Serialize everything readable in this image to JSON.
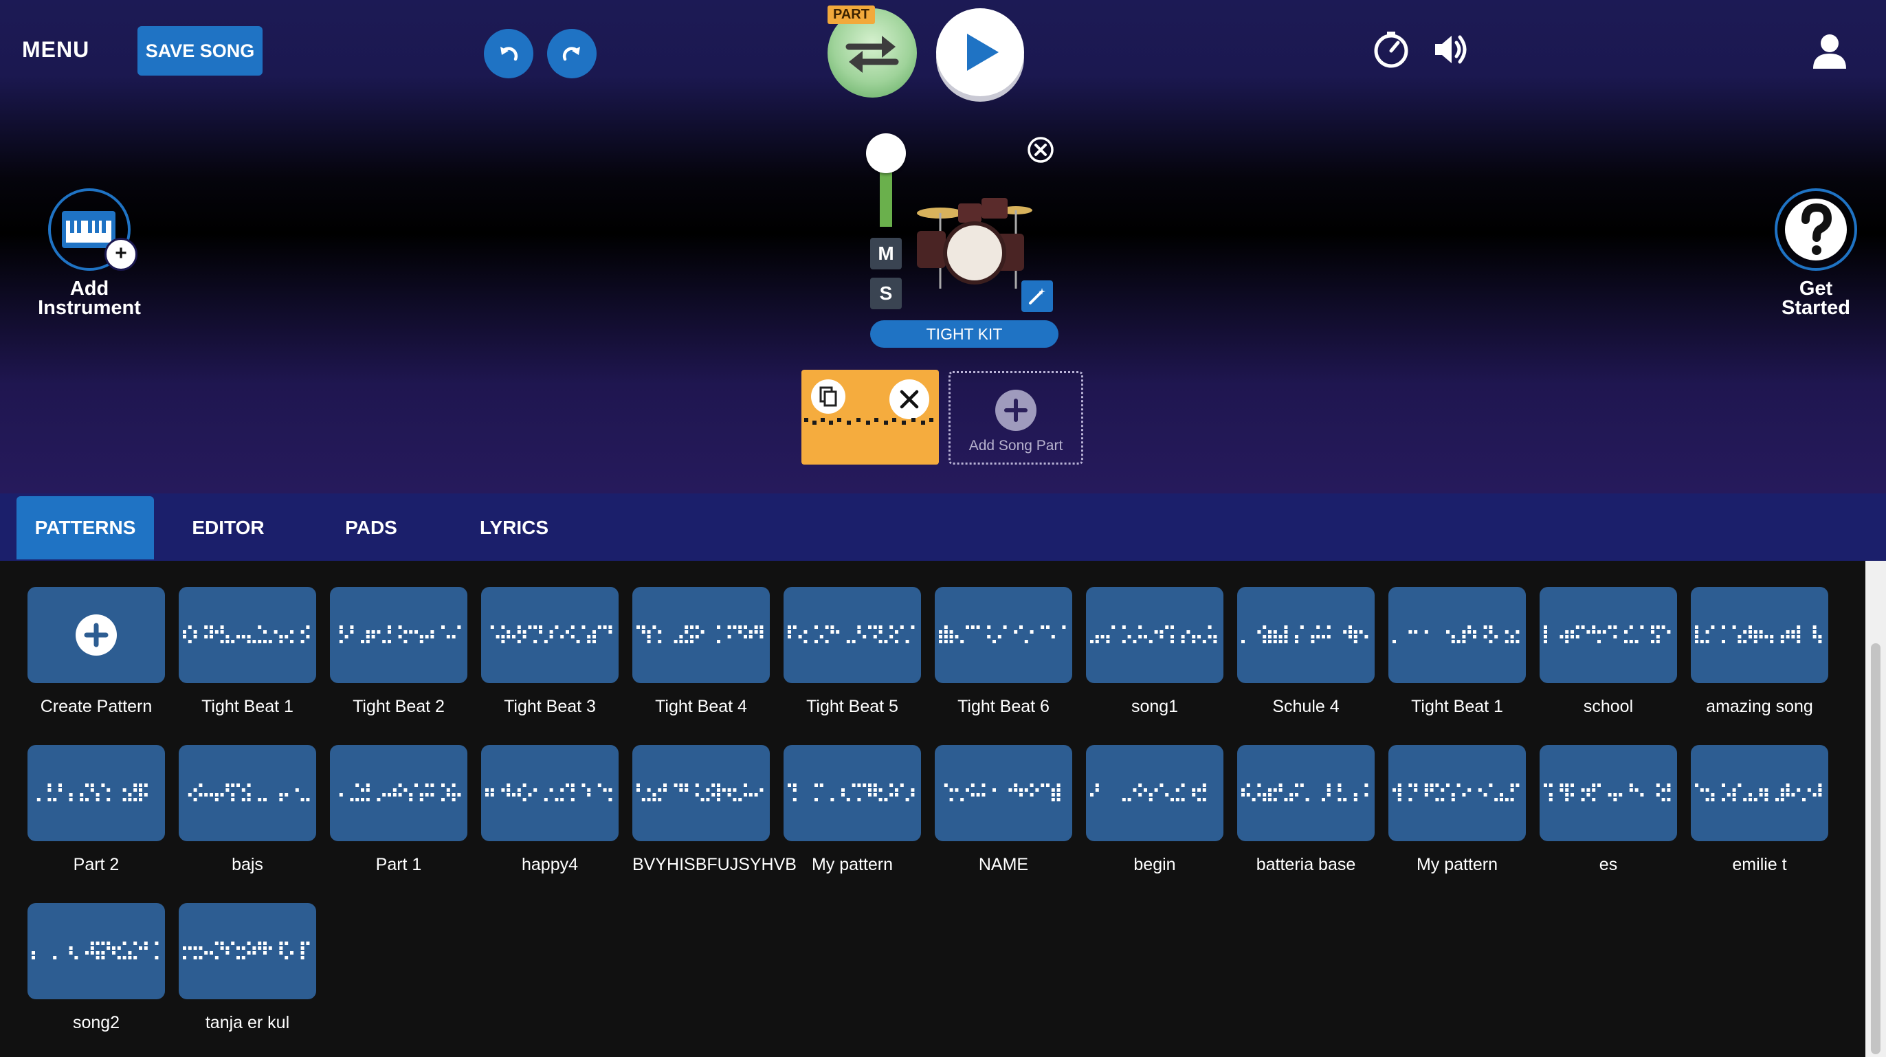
{
  "header": {
    "menu_label": "MENU",
    "save_label": "SAVE SONG",
    "part_badge": "PART",
    "undo_icon": "undo-icon",
    "redo_icon": "redo-icon",
    "metronome_icon": "metronome-icon",
    "volume_icon": "speaker-icon",
    "user_icon": "user-icon"
  },
  "left_action": {
    "label_line1": "Add",
    "label_line2": "Instrument",
    "icon": "keyboard-plus-icon"
  },
  "right_action": {
    "label_line1": "Get",
    "label_line2": "Started",
    "icon": "question-icon"
  },
  "instrument": {
    "name": "TIGHT KIT",
    "mute_label": "M",
    "solo_label": "S"
  },
  "song_parts": {
    "add_label": "Add Song Part"
  },
  "tabs": [
    {
      "label": "PATTERNS",
      "active": true
    },
    {
      "label": "EDITOR",
      "active": false
    },
    {
      "label": "PADS",
      "active": false
    },
    {
      "label": "LYRICS",
      "active": false
    }
  ],
  "patterns": [
    "Create Pattern",
    "Tight Beat 1",
    "Tight Beat 2",
    "Tight Beat 3",
    "Tight Beat 4",
    "Tight Beat 5",
    "Tight Beat 6",
    "song1",
    "Schule 4",
    "Tight Beat 1",
    "school",
    "amazing song",
    "Part 2",
    "bajs",
    "Part 1",
    "happy4",
    "BVYHISBFUJSYHVB",
    "My pattern",
    "NAME",
    "begin",
    "batteria base",
    "My pattern",
    "es",
    "emilie t",
    "song2",
    "tanja er kul"
  ],
  "colors": {
    "accent_blue": "#1f73c4",
    "tile_blue": "#2d5d92",
    "part_orange": "#f5ac3e",
    "fader_green": "#6ab04c"
  }
}
